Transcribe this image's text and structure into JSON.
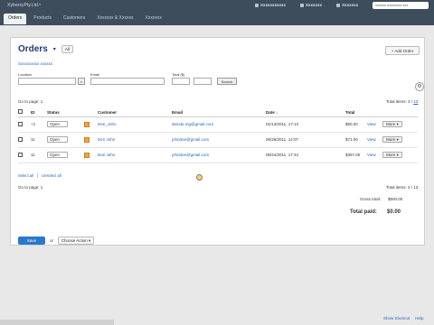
{
  "app": {
    "brand": "XybxxxyPty.Ltd.ⁱᵗ",
    "top_links": [
      "Xxxxxxxxxxx",
      "Xxxxxxx",
      "Xxxxxxx"
    ],
    "search_placeholder": "xxxxxx.xxxxxxxx.xxx",
    "nav_tabs": [
      "Orders",
      "Products",
      "Customers",
      "Xxxxxxx & Xxxxxx",
      "Xxxxxxx"
    ],
    "active_tab": "Orders"
  },
  "page": {
    "title": "Orders",
    "title_caret": "▾",
    "filter_value": "All",
    "add_order_label": "+ Add Order",
    "saved_search_text": "Sxxxxxxxxx xxxxxx"
  },
  "filters": {
    "location_label": "Location",
    "email_label": "Email",
    "total_label": "Total ($)",
    "search_button": "Search",
    "gear_glyph": "⚙"
  },
  "pagination": {
    "go_to_page_label": "Go to page:",
    "go_to_page_value": "1",
    "total_items_label": "Total items: 3 /",
    "total_items_link": "13"
  },
  "table": {
    "headers": [
      "",
      "ID",
      "Status",
      "",
      "Customer",
      "Email",
      "Date ↓",
      "Total",
      ""
    ],
    "rows": [
      {
        "id": "+1",
        "status": "Open",
        "customer": "Dee_John",
        "email": "stenda.mg@gmail.com",
        "date": "01/13/2011, 17:13",
        "total": "$50.00",
        "view": "View",
        "action": "More ▾"
      },
      {
        "id": "11",
        "status": "Open",
        "customer": "Den John",
        "email": "johndoe@gmail.com",
        "date": "05/26/2011, 14:07",
        "total": "$71.00",
        "view": "View",
        "action": "More ▾"
      },
      {
        "id": "11",
        "status": "Open",
        "customer": "Dee John",
        "email": "johndoe@gmail.com",
        "date": "05/24/2011, 17:34",
        "total": "$367.00",
        "view": "View",
        "action": "More ▾"
      }
    ],
    "footer_links": [
      "Select all",
      "Unselect all"
    ]
  },
  "summary": {
    "gross_label": "Gross total:",
    "gross_value": "$500.00",
    "total_paid_label": "Total paid:",
    "total_paid_value": "$0.00"
  },
  "bottom": {
    "primary_button": "Save",
    "or_label": "or",
    "secondary_button": "Choose Action ▾"
  },
  "footer_right": [
    "Show Shortcut",
    "Help"
  ],
  "colors": {
    "topbar": "#3d4d5c",
    "accent": "#2a62b7",
    "primary_button": "#2a78c8",
    "status_flag": "#f1a24d"
  }
}
